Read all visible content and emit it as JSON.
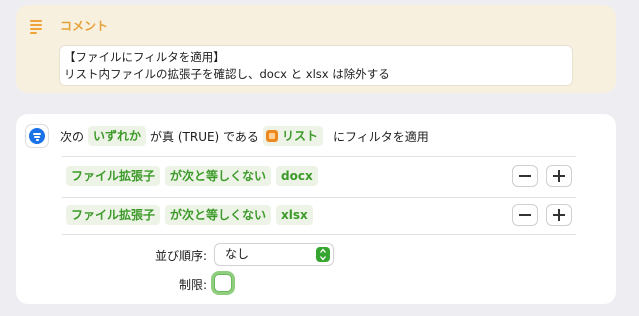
{
  "comment": {
    "title": "コメント",
    "icon": "text-lines-icon",
    "lines": [
      "【ファイルにフィルタを適用】",
      "リスト内ファイルの拡張子を確認し、docx と xlsx は除外する"
    ],
    "accent": "#e5a23a"
  },
  "filter": {
    "icon": "filter-icon",
    "header": {
      "prefix": "次の",
      "match_mode": "いずれか",
      "middle": "が真 (TRUE) である",
      "variable": "リスト",
      "suffix": "にフィルタを適用"
    },
    "conditions": [
      {
        "property": "ファイル拡張子",
        "operator": "が次と等しくない",
        "value": "docx"
      },
      {
        "property": "ファイル拡張子",
        "operator": "が次と等しくない",
        "value": "xlsx"
      }
    ],
    "sort_label": "並び順序:",
    "sort_value": "なし",
    "limit_label": "制限:",
    "limit_checked": false,
    "accent": "#3d9a2a"
  }
}
